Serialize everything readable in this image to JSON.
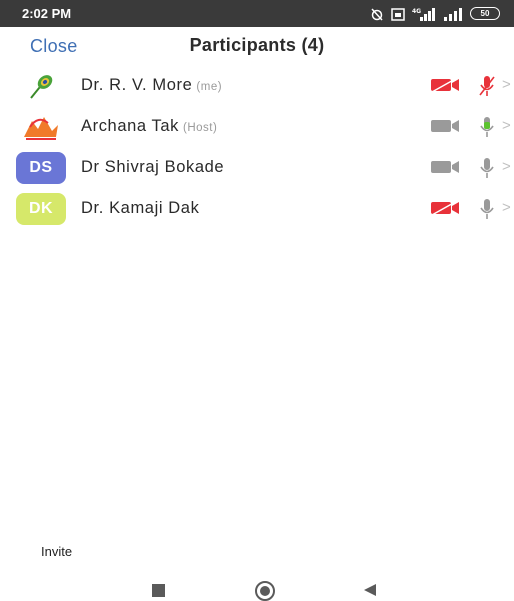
{
  "status_bar": {
    "time": "2:02 PM",
    "icons": [
      "alarm-icon",
      "calendar-icon",
      "signal-4g-icon",
      "signal-icon"
    ],
    "battery": "50"
  },
  "header": {
    "close_label": "Close",
    "title": "Participants (4)"
  },
  "participants": [
    {
      "name": "Dr. R. V. More",
      "tag": "(me)",
      "avatar_kind": "image",
      "avatar_icon": "peacock-feather-icon",
      "camera": "off",
      "mic": "muted"
    },
    {
      "name": "Archana Tak",
      "tag": "(Host)",
      "avatar_kind": "image",
      "avatar_icon": "orange-logo-icon",
      "camera": "on",
      "mic": "active"
    },
    {
      "name": "Dr Shivraj Bokade",
      "tag": "",
      "avatar_kind": "initials",
      "initials": "DS",
      "camera": "on",
      "mic": "on"
    },
    {
      "name": "Dr. Kamaji Dak",
      "tag": "",
      "avatar_kind": "initials",
      "initials": "DK",
      "camera": "off",
      "mic": "on"
    }
  ],
  "colors": {
    "close": "#3f6fb4",
    "camera_off": "#e8323a",
    "camera_on": "#9a9a9a",
    "mic_muted": "#e8323a",
    "mic_active": "#5cc330",
    "avatar_ds": "#6a76d6",
    "avatar_dk": "#d6e86a"
  },
  "footer": {
    "invite_label": "Invite"
  },
  "navbar": {
    "icons": [
      "recents-square-icon",
      "home-circle-icon",
      "back-triangle-icon"
    ]
  }
}
